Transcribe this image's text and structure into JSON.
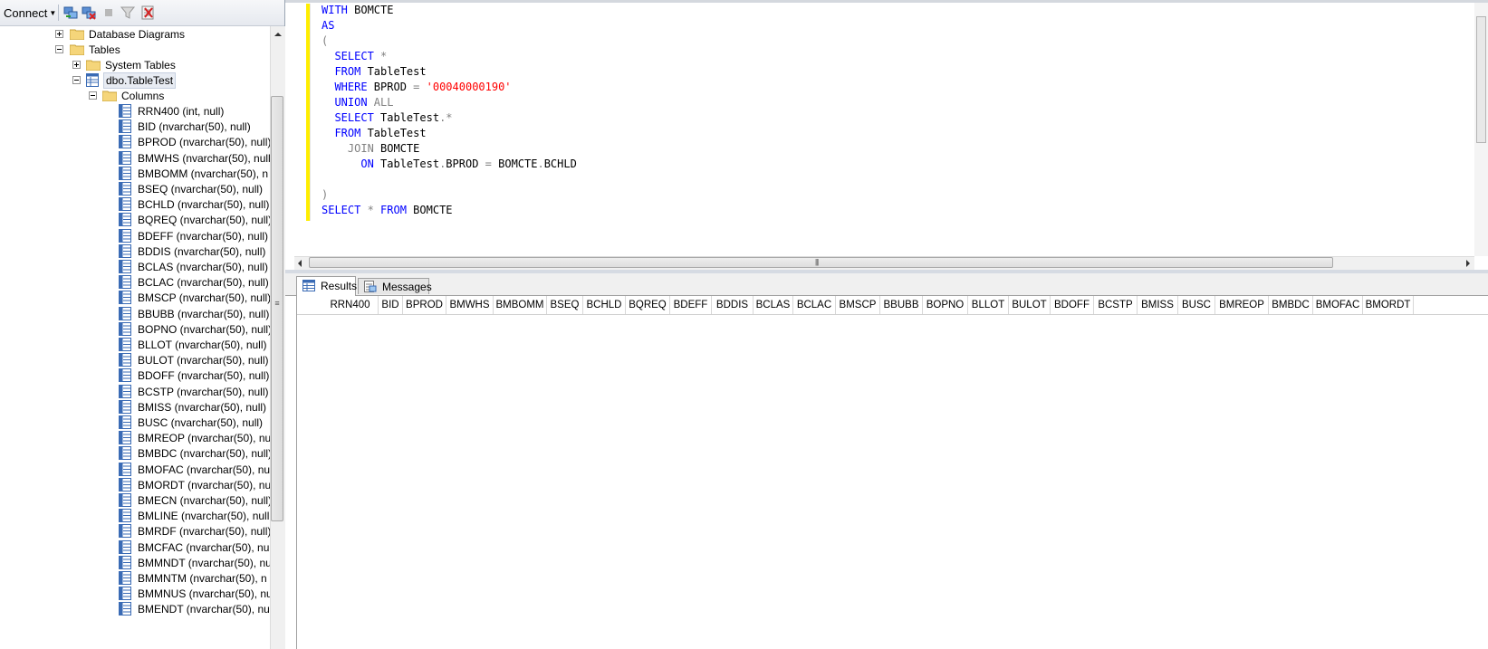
{
  "object_explorer": {
    "toolbar": {
      "connect_label": "Connect",
      "icons": [
        "connect-object-explorer-icon",
        "disconnect-icon",
        "stop-icon",
        "filter-icon",
        "refresh-icon"
      ]
    },
    "tree": {
      "database_diagrams": "Database Diagrams",
      "tables": "Tables",
      "system_tables": "System Tables",
      "table_name": "dbo.TableTest",
      "columns_folder": "Columns",
      "columns": [
        "RRN400 (int, null)",
        "BID (nvarchar(50), null)",
        "BPROD (nvarchar(50), null)",
        "BMWHS (nvarchar(50), null",
        "BMBOMM (nvarchar(50), n",
        "BSEQ (nvarchar(50), null)",
        "BCHLD (nvarchar(50), null)",
        "BQREQ (nvarchar(50), null)",
        "BDEFF (nvarchar(50), null)",
        "BDDIS (nvarchar(50), null)",
        "BCLAS (nvarchar(50), null)",
        "BCLAC (nvarchar(50), null)",
        "BMSCP (nvarchar(50), null)",
        "BBUBB (nvarchar(50), null)",
        "BOPNO (nvarchar(50), null)",
        "BLLOT (nvarchar(50), null)",
        "BULOT (nvarchar(50), null)",
        "BDOFF (nvarchar(50), null)",
        "BCSTP (nvarchar(50), null)",
        "BMISS (nvarchar(50), null)",
        "BUSC (nvarchar(50), null)",
        "BMREOP (nvarchar(50), nul",
        "BMBDC (nvarchar(50), null)",
        "BMOFAC (nvarchar(50), nu",
        "BMORDT (nvarchar(50), nu",
        "BMECN (nvarchar(50), null)",
        "BMLINE (nvarchar(50), null",
        "BMRDF (nvarchar(50), null)",
        "BMCFAC (nvarchar(50), nu",
        "BMMNDT (nvarchar(50), nu",
        "BMMNTM (nvarchar(50), n",
        "BMMNUS (nvarchar(50), nu",
        "BMENDT (nvarchar(50), nu"
      ]
    }
  },
  "editor": {
    "lines": [
      [
        {
          "t": "WITH",
          "c": "kw"
        },
        {
          "t": " BOMCTE",
          "c": ""
        }
      ],
      [
        {
          "t": "AS",
          "c": "kw"
        }
      ],
      [
        {
          "t": "(",
          "c": "gr"
        }
      ],
      [
        {
          "t": "  ",
          "c": ""
        },
        {
          "t": "SELECT",
          "c": "kw"
        },
        {
          "t": " *",
          "c": "gr"
        }
      ],
      [
        {
          "t": "  ",
          "c": ""
        },
        {
          "t": "FROM",
          "c": "kw"
        },
        {
          "t": " TableTest",
          "c": ""
        }
      ],
      [
        {
          "t": "  ",
          "c": ""
        },
        {
          "t": "WHERE",
          "c": "kw"
        },
        {
          "t": " BPROD ",
          "c": ""
        },
        {
          "t": "=",
          "c": "gr"
        },
        {
          "t": " '00040000190'",
          "c": "str"
        }
      ],
      [
        {
          "t": "  ",
          "c": ""
        },
        {
          "t": "UNION",
          "c": "kw"
        },
        {
          "t": " ALL",
          "c": "gr"
        }
      ],
      [
        {
          "t": "  ",
          "c": ""
        },
        {
          "t": "SELECT",
          "c": "kw"
        },
        {
          "t": " TableTest",
          "c": ""
        },
        {
          "t": ".*",
          "c": "gr"
        }
      ],
      [
        {
          "t": "  ",
          "c": ""
        },
        {
          "t": "FROM",
          "c": "kw"
        },
        {
          "t": " TableTest",
          "c": ""
        }
      ],
      [
        {
          "t": "    ",
          "c": ""
        },
        {
          "t": "JOIN",
          "c": "gr"
        },
        {
          "t": " BOMCTE",
          "c": ""
        }
      ],
      [
        {
          "t": "      ",
          "c": ""
        },
        {
          "t": "ON",
          "c": "kw"
        },
        {
          "t": " TableTest",
          "c": ""
        },
        {
          "t": ".",
          "c": "gr"
        },
        {
          "t": "BPROD ",
          "c": ""
        },
        {
          "t": "=",
          "c": "gr"
        },
        {
          "t": " BOMCTE",
          "c": ""
        },
        {
          "t": ".",
          "c": "gr"
        },
        {
          "t": "BCHLD",
          "c": ""
        }
      ],
      [],
      [
        {
          "t": ")",
          "c": "gr"
        }
      ],
      [
        {
          "t": "SELECT",
          "c": "kw"
        },
        {
          "t": " * ",
          "c": "gr"
        },
        {
          "t": "FROM",
          "c": "kw"
        },
        {
          "t": " BOMCTE",
          "c": ""
        }
      ]
    ]
  },
  "results": {
    "tab_results": "Results",
    "tab_messages": "Messages",
    "columns": [
      "RRN400",
      "BID",
      "BPROD",
      "BMWHS",
      "BMBOMM",
      "BSEQ",
      "BCHLD",
      "BQREQ",
      "BDEFF",
      "BDDIS",
      "BCLAS",
      "BCLAC",
      "BMSCP",
      "BBUBB",
      "BOPNO",
      "BLLOT",
      "BULOT",
      "BDOFF",
      "BCSTP",
      "BMISS",
      "BUSC",
      "BMREOP",
      "BMBDC",
      "BMOFAC",
      "BMORDT"
    ]
  },
  "colors": {
    "keyword": "#0000ff",
    "operator": "#808080",
    "string": "#ff0000",
    "change_bar": "#ffee00"
  }
}
